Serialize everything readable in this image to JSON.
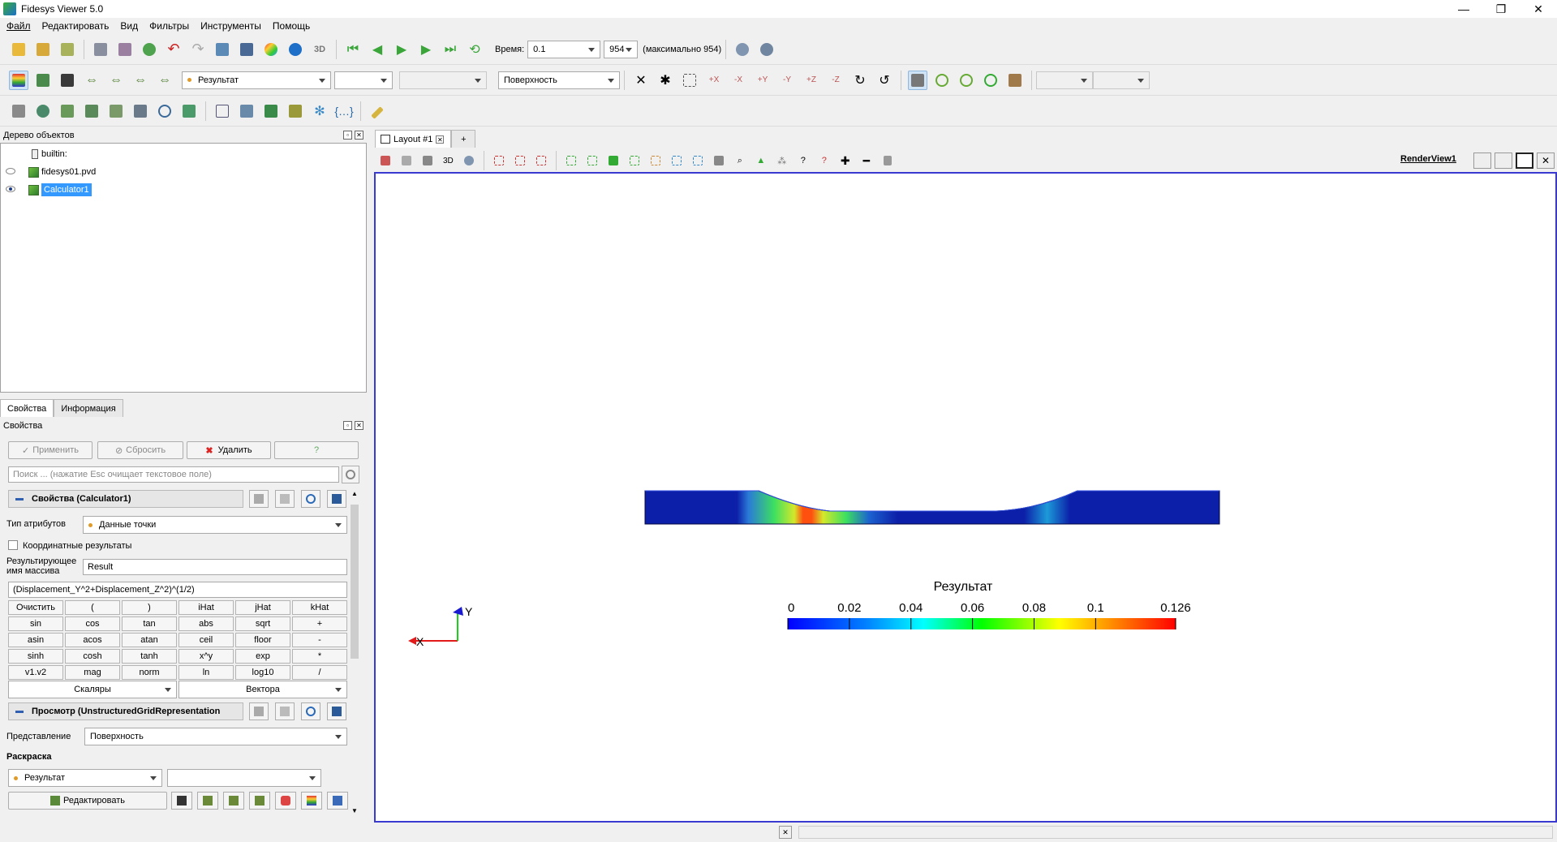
{
  "window": {
    "title": "Fidesys Viewer 5.0",
    "minimize": "—",
    "restore": "❐",
    "close": "✕"
  },
  "menu": [
    "Файл",
    "Редактировать",
    "Вид",
    "Фильтры",
    "Инструменты",
    "Помощь"
  ],
  "toolbar1": {
    "time_label": "Время:",
    "time_value": "0.1",
    "step_value": "954",
    "max_label": "(максимально 954)"
  },
  "toolbar2": {
    "color_array": "Результат",
    "representation": "Поверхность"
  },
  "pipeline": {
    "header": "Дерево объектов",
    "items": [
      "builtin:",
      "fidesys01.pvd",
      "Calculator1"
    ]
  },
  "tabs": [
    "Свойства",
    "Информация"
  ],
  "properties": {
    "header": "Свойства",
    "apply": "Применить",
    "reset": "Сбросить",
    "delete": "Удалить",
    "help": "?",
    "search_placeholder": "Поиск ... (нажатие Esc очищает текстовое поле)",
    "section1": "Свойства (Calculator1)",
    "attr_type_label": "Тип атрибутов",
    "attr_type_value": "Данные точки",
    "coord_results": "Координатные результаты",
    "result_name_label_1": "Результирующее",
    "result_name_label_2": "имя массива",
    "result_name_value": "Result",
    "expression": "(Displacement_Y^2+Displacement_Z^2)^(1/2)",
    "calc_rows": [
      [
        "Очистить",
        "(",
        ")",
        "iHat",
        "jHat",
        "kHat"
      ],
      [
        "sin",
        "cos",
        "tan",
        "abs",
        "sqrt",
        "+"
      ],
      [
        "asin",
        "acos",
        "atan",
        "ceil",
        "floor",
        "-"
      ],
      [
        "sinh",
        "cosh",
        "tanh",
        "x^y",
        "exp",
        "*"
      ],
      [
        "v1.v2",
        "mag",
        "norm",
        "ln",
        "log10",
        "/"
      ]
    ],
    "scalars": "Скаляры",
    "vectors": "Вектора",
    "section2": "Просмотр (UnstructuredGridRepresentation",
    "repr_label": "Представление",
    "repr_value": "Поверхность",
    "coloring_label": "Раскраска",
    "coloring_value": "Результат",
    "edit": "Редактировать"
  },
  "view": {
    "layout_tab": "Layout #1",
    "add_tab": "+",
    "threed": "3D",
    "render_view_name": "RenderView1"
  },
  "colorbar": {
    "title": "Результат",
    "ticks": [
      "0",
      "0.02",
      "0.04",
      "0.06",
      "0.08",
      "0.1",
      "0.126"
    ]
  },
  "axes": {
    "x": "X",
    "y": "Y"
  },
  "colors": {
    "selection": "#3399ff",
    "render_border": "#3a3ad0",
    "model_base": "#0c1fa8"
  }
}
